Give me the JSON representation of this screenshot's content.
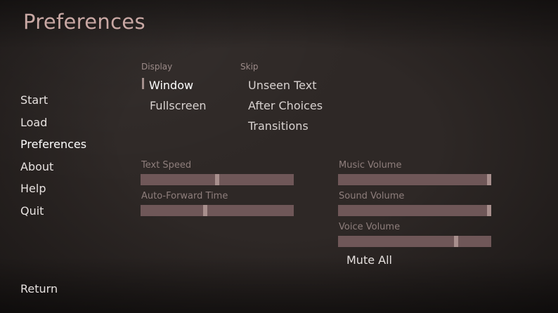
{
  "screen_title": "Preferences",
  "nav": {
    "items": [
      {
        "label": "Start"
      },
      {
        "label": "Load"
      },
      {
        "label": "Preferences",
        "active": true
      },
      {
        "label": "About"
      },
      {
        "label": "Help"
      },
      {
        "label": "Quit"
      }
    ],
    "return_label": "Return"
  },
  "display": {
    "label": "Display",
    "options": [
      "Window",
      "Fullscreen"
    ],
    "selected": "Window"
  },
  "skip": {
    "label": "Skip",
    "options": [
      "Unseen Text",
      "After Choices",
      "Transitions"
    ]
  },
  "sliders": {
    "text_speed": {
      "label": "Text Speed",
      "value": 0.5
    },
    "auto_forward_time": {
      "label": "Auto-Forward Time",
      "value": 0.42
    },
    "music_volume": {
      "label": "Music Volume",
      "value": 1.0
    },
    "sound_volume": {
      "label": "Sound Volume",
      "value": 1.0
    },
    "voice_volume": {
      "label": "Voice Volume",
      "value": 0.78
    }
  },
  "mute_all_label": "Mute All",
  "colors": {
    "background": "#2e2826",
    "title": "#c9a8a4",
    "bar_track": "#6f5758",
    "bar_thumb": "#a88f8d"
  }
}
